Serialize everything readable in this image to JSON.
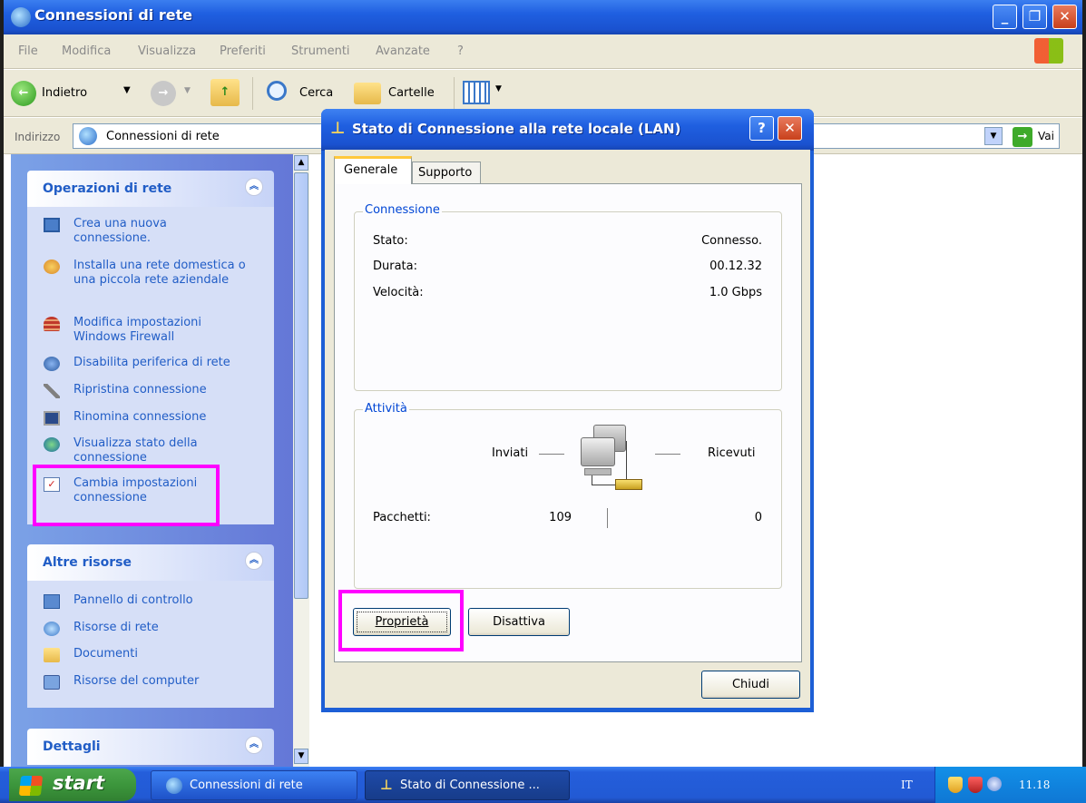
{
  "window": {
    "title": "Connessioni di rete",
    "menu": [
      "File",
      "Modifica",
      "Visualizza",
      "Preferiti",
      "Strumenti",
      "Avanzate",
      "?"
    ],
    "toolbar": {
      "back_label": "Indietro",
      "search_label": "Cerca",
      "folders_label": "Cartelle"
    },
    "address": {
      "label": "Indirizzo",
      "value": "Connessioni di rete",
      "go_label": "Vai"
    }
  },
  "sidebar": {
    "network_tasks": {
      "title": "Operazioni di rete",
      "items": [
        {
          "label": "Crea una nuova connessione.",
          "icon": "new-connection-icon"
        },
        {
          "label": "Installa una rete domestica o una piccola rete aziendale",
          "icon": "home-network-icon"
        },
        {
          "label": "Modifica impostazioni Windows Firewall",
          "icon": "firewall-icon"
        },
        {
          "label": "Disabilita periferica di rete",
          "icon": "disable-device-icon"
        },
        {
          "label": "Ripristina connessione",
          "icon": "repair-icon"
        },
        {
          "label": "Rinomina connessione",
          "icon": "rename-icon"
        },
        {
          "label": "Visualizza stato della connessione",
          "icon": "status-icon"
        },
        {
          "label": "Cambia impostazioni connessione",
          "icon": "settings-icon"
        }
      ]
    },
    "other_places": {
      "title": "Altre risorse",
      "items": [
        {
          "label": "Pannello di controllo",
          "icon": "control-panel-icon"
        },
        {
          "label": "Risorse di rete",
          "icon": "network-places-icon"
        },
        {
          "label": "Documenti",
          "icon": "documents-icon"
        },
        {
          "label": "Risorse del computer",
          "icon": "my-computer-icon"
        }
      ]
    },
    "details": {
      "title": "Dettagli"
    }
  },
  "dialog": {
    "title": "Stato di Connessione alla rete locale (LAN)",
    "help_label": "?",
    "tabs": [
      "Generale",
      "Supporto"
    ],
    "connection": {
      "group_label": "Connessione",
      "rows": [
        {
          "label": "Stato:",
          "value": "Connesso."
        },
        {
          "label": "Durata:",
          "value": "00.12.32"
        },
        {
          "label": "Velocità:",
          "value": "1.0 Gbps"
        }
      ]
    },
    "activity": {
      "group_label": "Attività",
      "sent_label": "Inviati",
      "received_label": "Ricevuti",
      "packets_label": "Pacchetti:",
      "packets_sent": "109",
      "packets_received": "0"
    },
    "buttons": {
      "properties": "Proprietà",
      "disable": "Disattiva",
      "close": "Chiudi"
    }
  },
  "taskbar": {
    "start_label": "start",
    "tasks": [
      "Connessioni di rete",
      "Stato di Connessione ..."
    ],
    "language": "IT",
    "clock": "11.18"
  },
  "colors": {
    "highlight": "#ff00ff",
    "xp_blue": "#1f5fe0",
    "link_blue": "#215dc6"
  }
}
